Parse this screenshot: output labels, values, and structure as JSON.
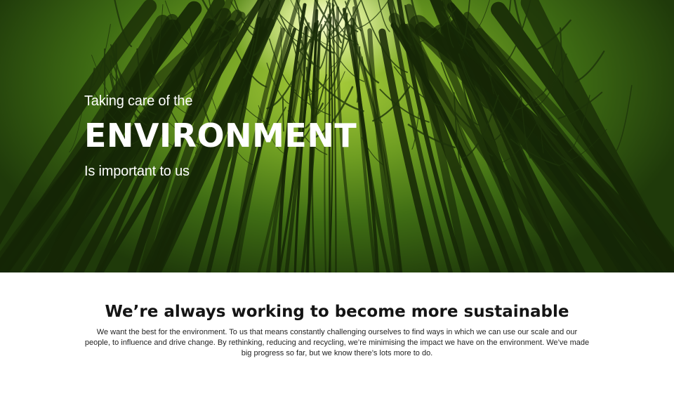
{
  "hero": {
    "line1": "Taking care of the",
    "title": "ENVIRONMENT",
    "line3": "Is important to us"
  },
  "section": {
    "heading": "We’re always working to become more sustainable",
    "body": "We want the best for the environment. To us that means constantly challenging ourselves to find ways in which we can use our scale and our people, to influence and drive change. By rethinking, reducing and recycling, we’re minimising the impact we have on the environment. We’ve made big progress so far, but we know there’s lots more to do."
  },
  "colors": {
    "hero_text": "#ffffff",
    "forest_dark": "#1b3008",
    "forest_light": "#a7cc3a",
    "heading": "#141414"
  }
}
